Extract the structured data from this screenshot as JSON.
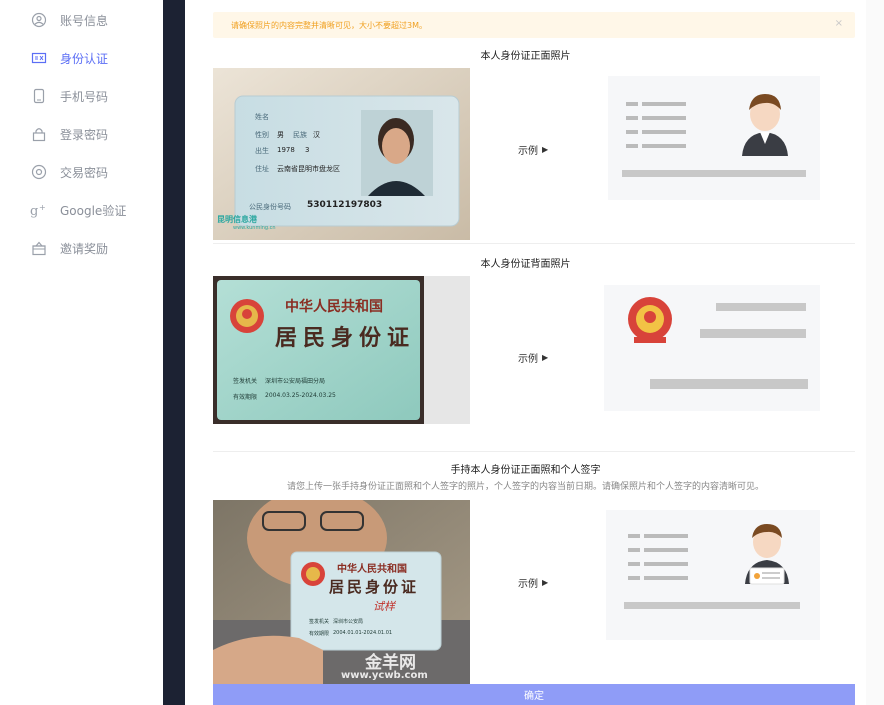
{
  "sidebar": {
    "items": [
      {
        "label": "账号信息",
        "icon": "user-circle-icon",
        "active": false
      },
      {
        "label": "身份认证",
        "icon": "id-card-icon",
        "active": true
      },
      {
        "label": "手机号码",
        "icon": "phone-icon",
        "active": false
      },
      {
        "label": "登录密码",
        "icon": "lock-icon",
        "active": false
      },
      {
        "label": "交易密码",
        "icon": "record-icon",
        "active": false
      },
      {
        "label": "Google验证",
        "icon": "google-plus-icon",
        "active": false
      },
      {
        "label": "邀请奖励",
        "icon": "gift-icon",
        "active": false
      }
    ]
  },
  "notice": {
    "text": "请确保照片的内容完整并清晰可见，大小不要超过3M。",
    "close": "×"
  },
  "sections": [
    {
      "title": "本人身份证正面照片",
      "example": "示例"
    },
    {
      "title": "本人身份证背面照片",
      "example": "示例"
    },
    {
      "title": "手持本人身份证正面照和个人签字",
      "subtitle": "请您上传一张手持身份证正面照和个人签字的照片，个人签字的内容当前日期。请确保照片和个人签字的内容清晰可见。",
      "example": "示例"
    }
  ],
  "photos": {
    "front": {
      "name_label": "姓名",
      "sex_label": "性别",
      "sex_value": "男",
      "ethnicity_label": "民族",
      "ethnicity_value": "汉",
      "birth_label": "出生",
      "birth_year": "1978",
      "birth_month": "3",
      "address_label": "住址",
      "address_value": "云南省昆明市盘龙区",
      "id_label": "公民身份号码",
      "id_value": "530112197803",
      "watermark": "昆明信息港",
      "watermark_url": "www.kunming.cn"
    },
    "back": {
      "country": "中华人民共和国",
      "card_title": "居民身份证",
      "authority_label": "签发机关",
      "authority_value": "深圳市公安局福田分局",
      "validity_label": "有效期限",
      "validity_value": "2004.03.25-2024.03.25"
    },
    "hand": {
      "country": "中华人民共和国",
      "card_title": "居民身份证",
      "stamp": "试样",
      "authority_label": "签发机关",
      "authority_value": "深圳市公安局",
      "validity_label": "有效期限",
      "validity_value": "2004.01.01-2024.01.01",
      "watermark": "金羊网",
      "watermark_url": "www.ycwb.com"
    }
  },
  "confirm_label": "确定",
  "colors": {
    "accent": "#5b6ef5",
    "notice_bg": "#fff7e8",
    "notice_text": "#f0a020",
    "confirm": "#8f9cf7",
    "sidebar_divider": "#1c2233"
  }
}
